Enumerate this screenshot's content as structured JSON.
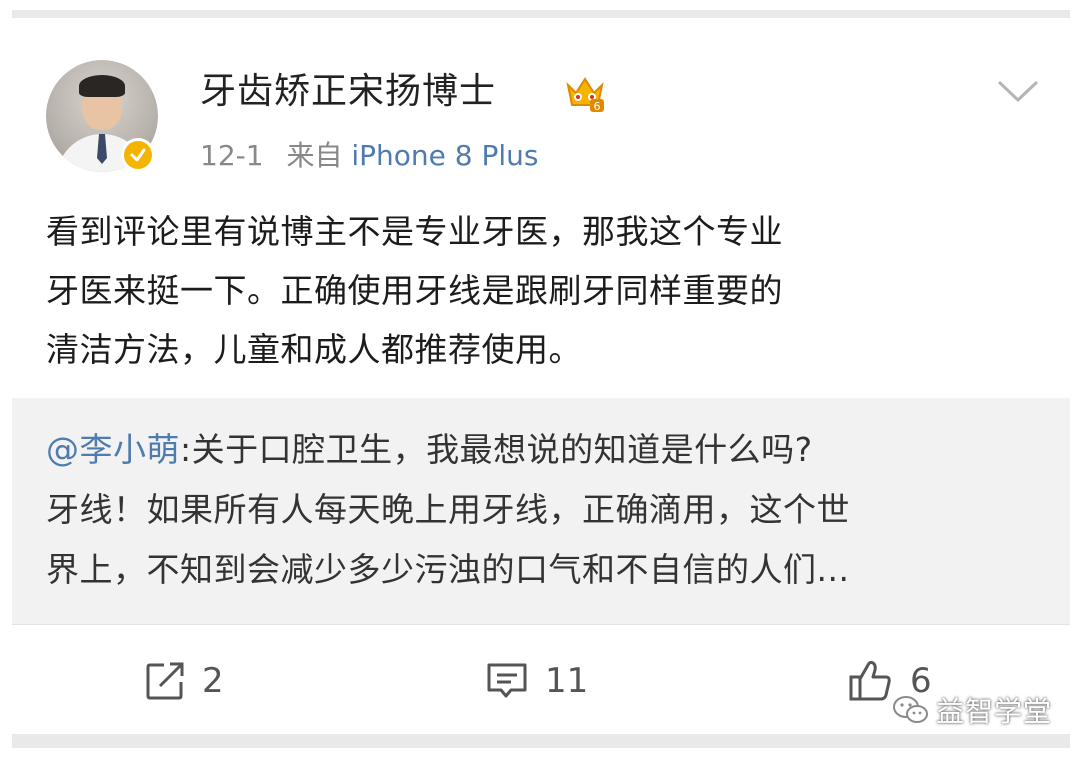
{
  "post": {
    "username": "牙齿矫正宋扬博士",
    "date": "12-1",
    "source_prefix": "来自",
    "source_device": "iPhone 8 Plus",
    "body_lines": [
      "看到评论里有说博主不是专业牙医，那我这个专业",
      "牙医来挺一下。正确使用牙线是跟刷牙同样重要的",
      "清洁方法，儿童和成人都推荐使用。"
    ]
  },
  "repost": {
    "mention": "@李小萌",
    "lines": [
      ":关于口腔卫生，我最想说的知道是什么吗?",
      "牙线！如果所有人每天晚上用牙线，正确滴用，这个世",
      "界上，不知到会减少多少污浊的口气和不自信的人们..."
    ]
  },
  "actions": {
    "repost_count": "2",
    "comment_count": "11",
    "like_count": "6"
  },
  "watermark": {
    "text": "益智学堂"
  },
  "icons": {
    "verified": "verified-badge-icon",
    "crown": "crown-level-icon",
    "dropdown": "chevron-down-icon",
    "repost": "share-icon",
    "comment": "comment-icon",
    "like": "thumbs-up-icon",
    "watermark": "wechat-icon"
  },
  "colors": {
    "link": "#4f7cae",
    "verified_gold": "#f5b400",
    "quote_background": "#f2f2f2"
  }
}
